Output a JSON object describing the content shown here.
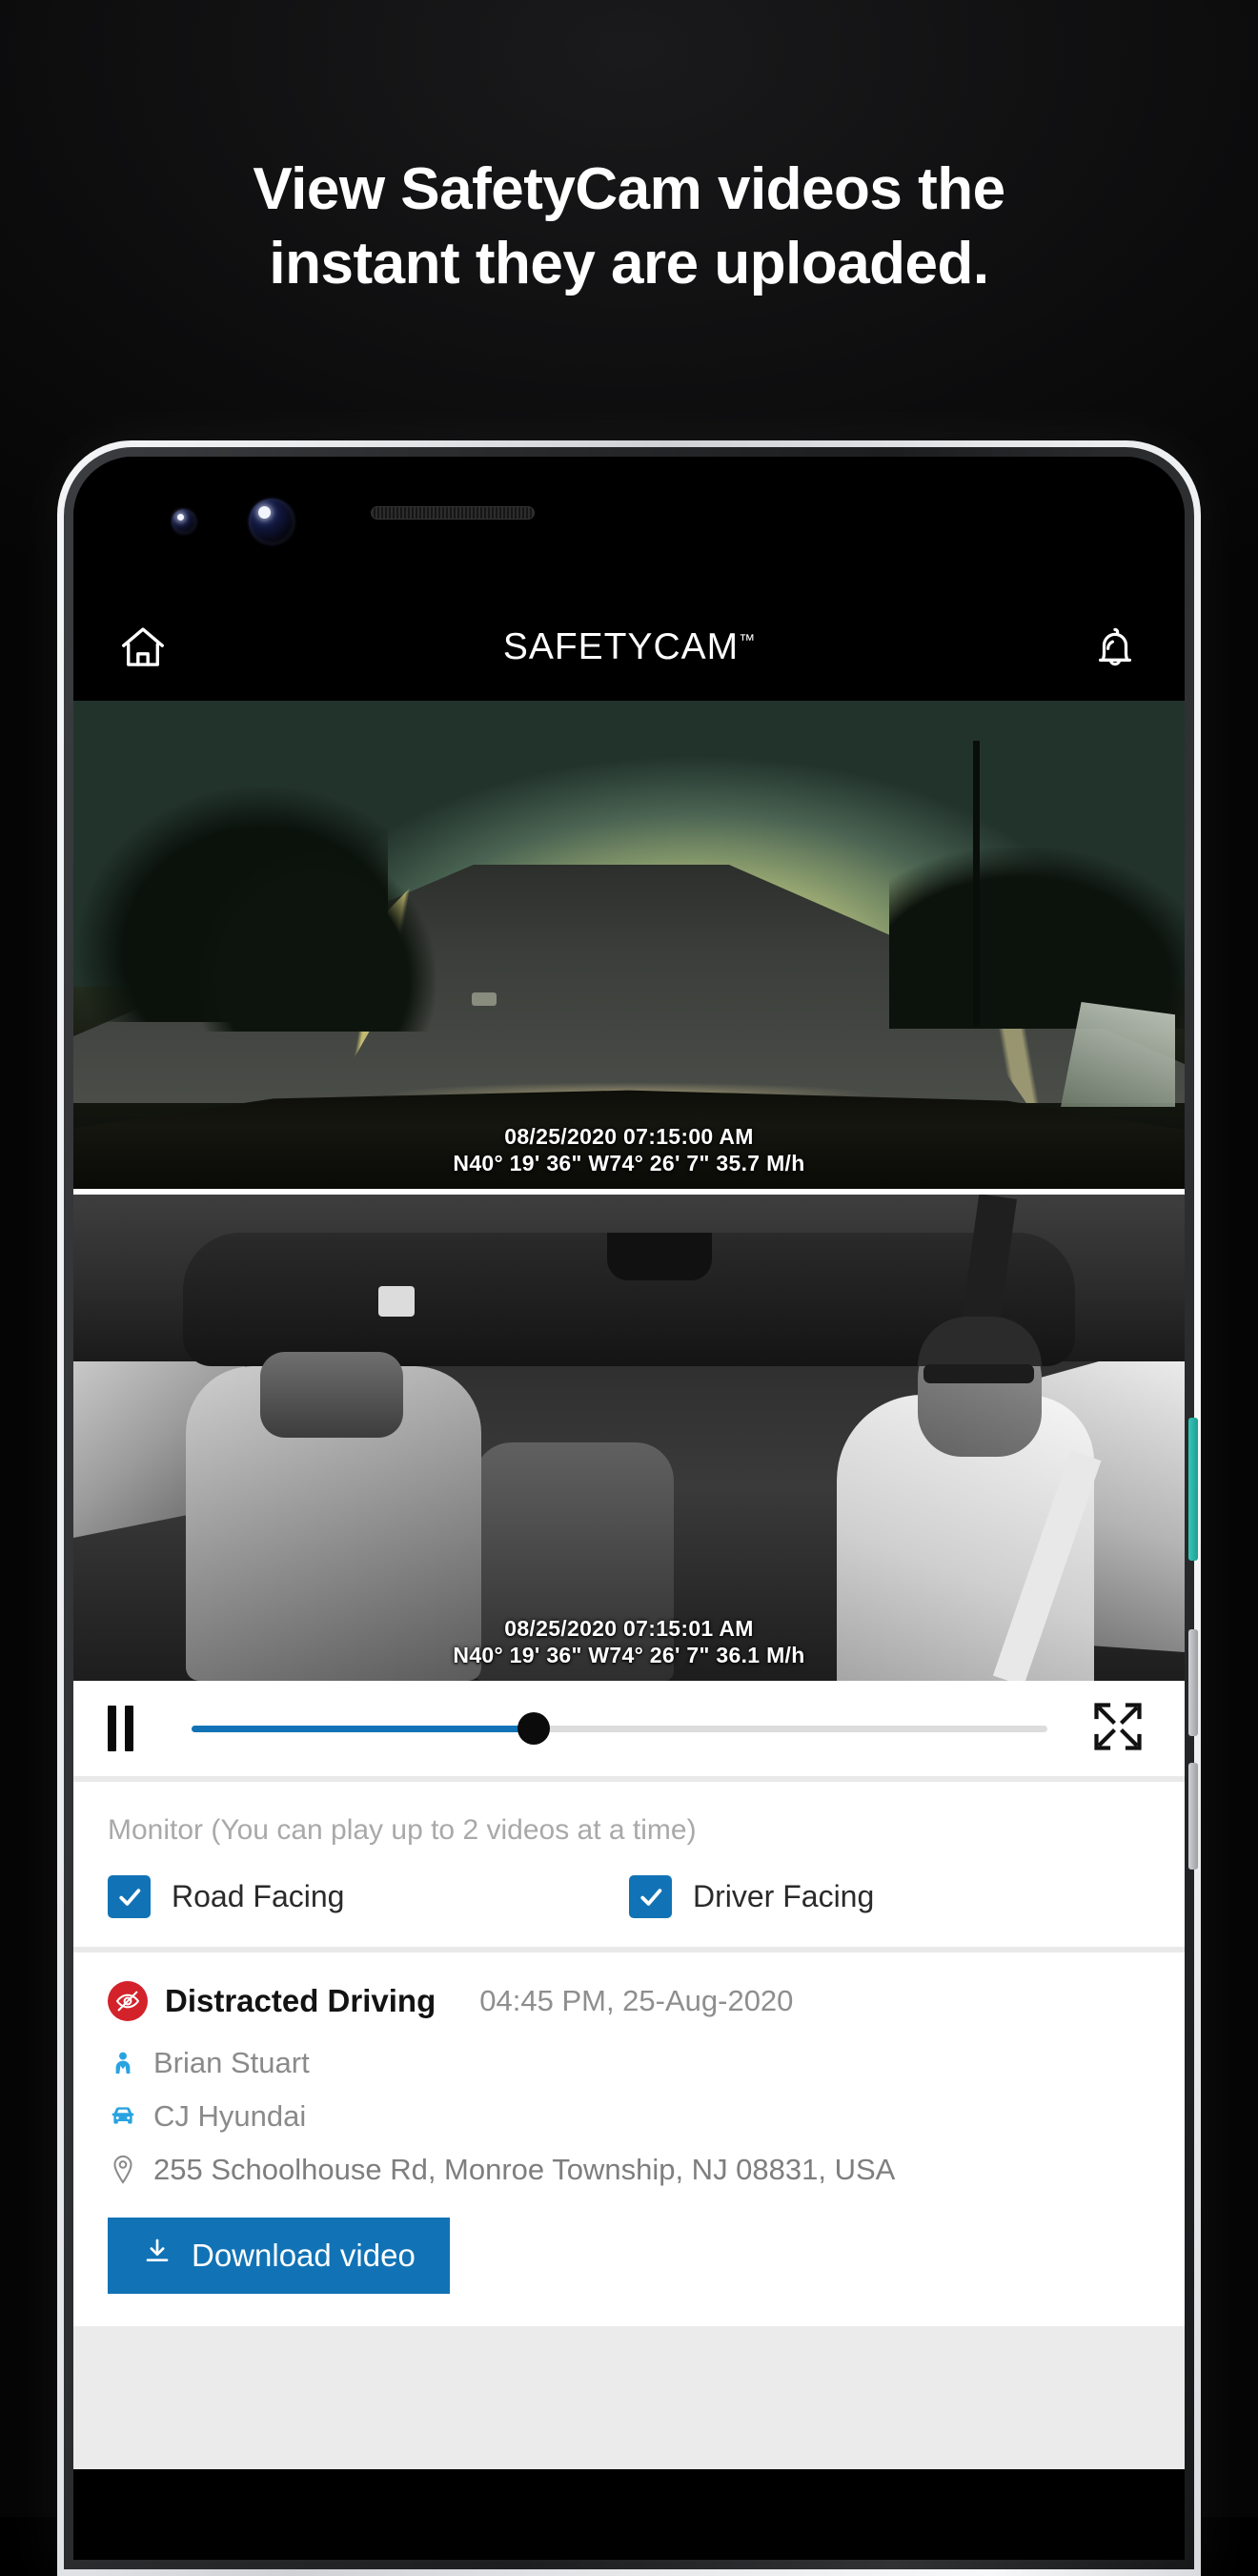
{
  "headline": {
    "line1": "View SafetyCam videos the",
    "line2": "instant they are uploaded."
  },
  "phone": {
    "appbar": {
      "home_icon": "home-icon",
      "title": "SAFETYCAM",
      "trademark": "™",
      "bell_icon": "bell-icon"
    },
    "videos": [
      {
        "name": "road-facing-video",
        "overlay_line1": "08/25/2020 07:15:00 AM",
        "overlay_line2": "N40° 19' 36\" W74° 26' 7\" 35.7 M/h"
      },
      {
        "name": "driver-facing-video",
        "overlay_line1": "08/25/2020 07:15:01 AM",
        "overlay_line2": "N40° 19' 36\" W74° 26' 7\" 36.1 M/h"
      }
    ],
    "player": {
      "state_icon": "pause-icon",
      "progress_percent": 40,
      "fullscreen_icon": "fullscreen-icon",
      "accent_color": "#1173b6"
    },
    "monitor": {
      "label": "Monitor (You can play up to 2 videos at a time)",
      "options": [
        {
          "label": "Road Facing",
          "checked": true
        },
        {
          "label": "Driver Facing",
          "checked": true
        }
      ]
    },
    "event": {
      "type_icon": "distracted-driving-icon",
      "type_color": "#d3222a",
      "title": "Distracted Driving",
      "timestamp": "04:45 PM, 25-Aug-2020",
      "driver_icon": "driver-icon",
      "driver": "Brian Stuart",
      "vehicle_icon": "car-icon",
      "vehicle": "CJ Hyundai",
      "location_icon": "map-pin-icon",
      "location": "255 Schoolhouse Rd, Monroe Township, NJ 08831, USA",
      "download_icon": "download-icon",
      "download_label": "Download video"
    }
  }
}
